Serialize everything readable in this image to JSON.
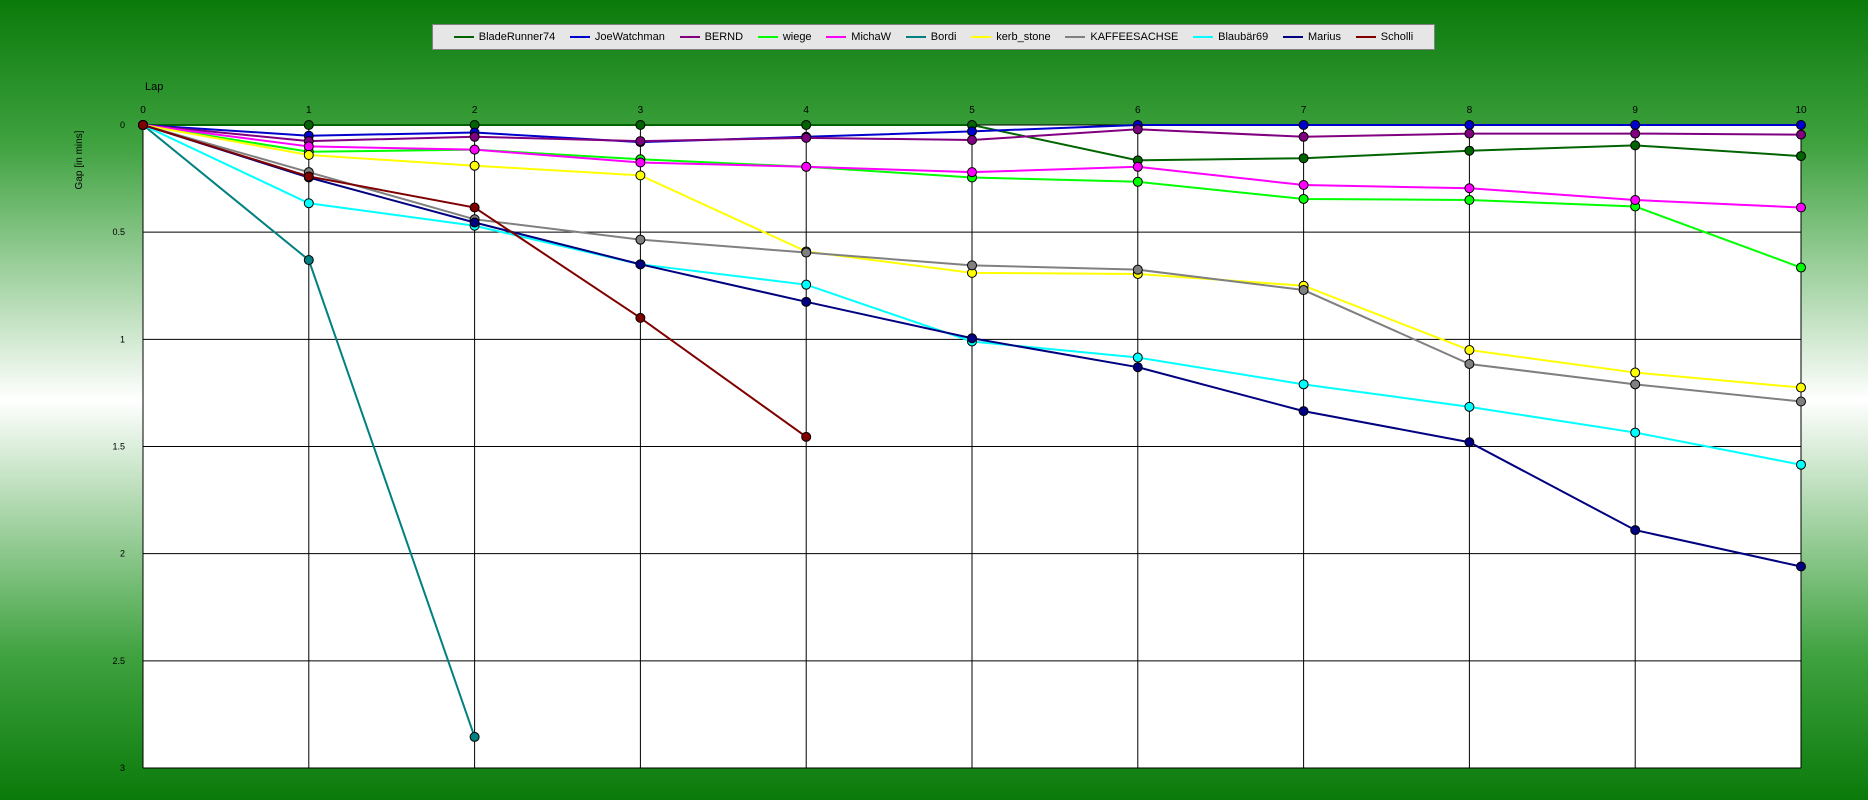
{
  "chart_data": {
    "type": "line",
    "xlabel": "Lap",
    "ylabel": "Gap [in mins]",
    "x": [
      0,
      1,
      2,
      3,
      4,
      5,
      6,
      7,
      8,
      9,
      10
    ],
    "xlim": [
      0,
      10
    ],
    "ylim": [
      0,
      3
    ],
    "y_inverted": true,
    "x_axis_position": "top",
    "y_ticks": [
      0,
      0.5,
      1,
      1.5,
      2,
      2.5,
      3
    ],
    "y_tick_labels": [
      "0",
      "0.5",
      "1",
      "1.5",
      "2",
      "2.5",
      "3"
    ],
    "x_tick_labels": [
      "0",
      "1",
      "2",
      "3",
      "4",
      "5",
      "6",
      "7",
      "8",
      "9",
      "10"
    ],
    "grid": true,
    "legend_position": "top",
    "series": [
      {
        "name": "BladeRunner74",
        "color": "#006400",
        "values": [
          0,
          0,
          0,
          0,
          0,
          0,
          0.165,
          0.155,
          0.12,
          0.095,
          0.145
        ]
      },
      {
        "name": "JoeWatchman",
        "color": "#0000cd",
        "values": [
          0,
          0.05,
          0.035,
          0.08,
          0.055,
          0.03,
          0,
          0,
          0,
          0,
          0
        ]
      },
      {
        "name": "BERND",
        "color": "#800080",
        "values": [
          0,
          0.075,
          0.055,
          0.075,
          0.06,
          0.07,
          0.02,
          0.055,
          0.04,
          0.04,
          0.045
        ]
      },
      {
        "name": "wiege",
        "color": "#00ff00",
        "values": [
          0,
          0.125,
          0.115,
          0.16,
          0.195,
          0.245,
          0.265,
          0.345,
          0.35,
          0.38,
          0.665
        ]
      },
      {
        "name": "MichaW",
        "color": "#ff00ff",
        "values": [
          0,
          0.1,
          0.115,
          0.175,
          0.195,
          0.22,
          0.195,
          0.28,
          0.295,
          0.35,
          0.385
        ]
      },
      {
        "name": "Bordi",
        "color": "#008080",
        "values": [
          0,
          0.63,
          2.855,
          null,
          null,
          null,
          null,
          null,
          null,
          null,
          null
        ]
      },
      {
        "name": "kerb_stone",
        "color": "#ffff00",
        "values": [
          0,
          0.14,
          0.19,
          0.235,
          0.59,
          0.69,
          0.695,
          0.75,
          1.05,
          1.155,
          1.225
        ]
      },
      {
        "name": "KAFFEESACHSE",
        "color": "#808080",
        "values": [
          0,
          0.22,
          0.44,
          0.535,
          0.595,
          0.655,
          0.675,
          0.77,
          1.115,
          1.21,
          1.29
        ]
      },
      {
        "name": "Blaubär69",
        "color": "#00ffff",
        "values": [
          0,
          0.365,
          0.47,
          0.65,
          0.745,
          1.01,
          1.085,
          1.21,
          1.315,
          1.435,
          1.585
        ]
      },
      {
        "name": "Marius",
        "color": "#000080",
        "values": [
          0,
          0.245,
          0.455,
          0.65,
          0.825,
          0.995,
          1.13,
          1.335,
          1.48,
          1.89,
          2.06
        ]
      },
      {
        "name": "Scholli",
        "color": "#800000",
        "values": [
          0,
          0.24,
          0.385,
          0.9,
          1.455,
          null,
          null,
          null,
          null,
          null,
          null
        ]
      }
    ]
  }
}
